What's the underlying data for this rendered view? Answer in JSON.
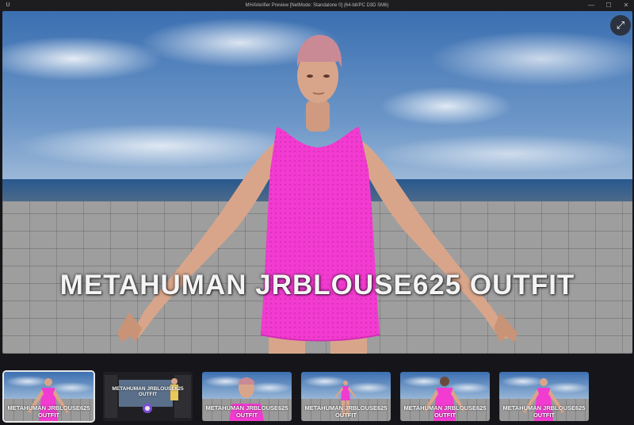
{
  "window": {
    "title": "MHAVerifier Preview [NetMode: Standalone 0]  (64-bit/PC D3D SM6)",
    "app_icon": "unreal-logo-icon",
    "min_glyph": "—",
    "max_glyph": "☐",
    "close_glyph": "✕"
  },
  "viewer": {
    "overlay_title": "METAHUMAN JRBLOUSE625 OUTFIT",
    "fullscreen_glyph": "⤢",
    "colors": {
      "dress": "#f23bd0",
      "skin": "#d9a58a",
      "hair": "#c98a96"
    }
  },
  "thumbnails": [
    {
      "caption": "METAHUMAN JRBLOUSE625 OUTFIT",
      "kind": "front-view",
      "selected": true
    },
    {
      "caption": "METAHUMAN JRBLOUSE625 OUTFIT",
      "kind": "editor-view",
      "selected": false
    },
    {
      "caption": "METAHUMAN JRBLOUSE625 OUTFIT",
      "kind": "portrait-view",
      "selected": false
    },
    {
      "caption": "METAHUMAN JRBLOUSE625 OUTFIT",
      "kind": "full-body-view",
      "selected": false
    },
    {
      "caption": "METAHUMAN JRBLOUSE625 OUTFIT",
      "kind": "back-view",
      "selected": false
    },
    {
      "caption": "METAHUMAN JRBLOUSE625 OUTFIT",
      "kind": "front-view-2",
      "selected": false
    }
  ]
}
